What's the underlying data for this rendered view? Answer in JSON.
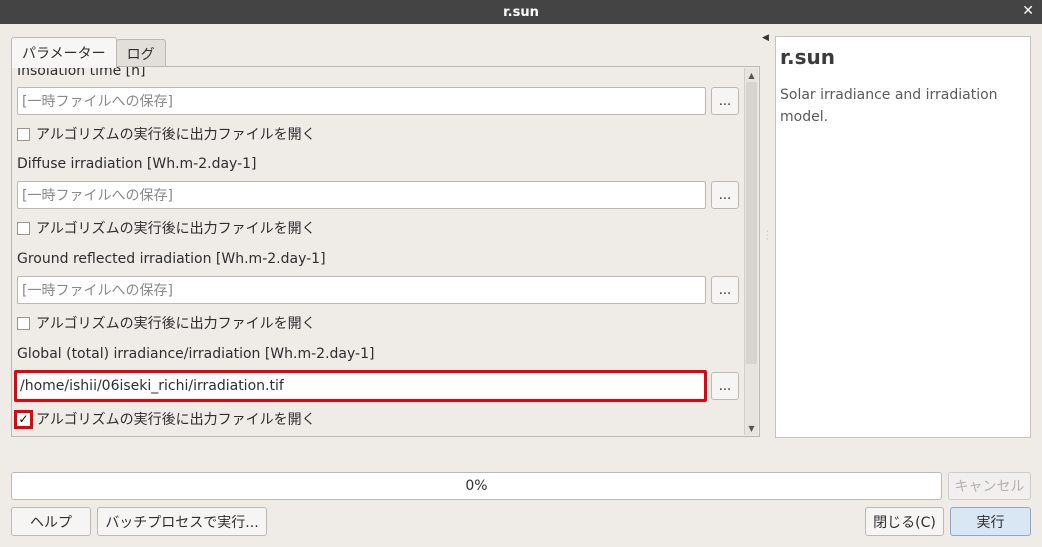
{
  "window": {
    "title": "r.sun",
    "close_icon": "✕"
  },
  "tabs": [
    {
      "label": "パラメーター",
      "active": true
    },
    {
      "label": "ログ",
      "active": false
    }
  ],
  "params": {
    "insolation_label": "Insolation time [h]",
    "temp_placeholder": "[一時ファイルへの保存]",
    "open_after_label": "アルゴリズムの実行後に出力ファイルを開く",
    "browse_label": "...",
    "diffuse_label": "Diffuse irradiation [Wh.m-2.day-1]",
    "ground_label": "Ground reflected irradiation [Wh.m-2.day-1]",
    "global_label": "Global (total) irradiance/irradiation [Wh.m-2.day-1]",
    "global_value": "/home/ishii/06iseki_richi/irradiation.tif",
    "global_checked_mark": "✓"
  },
  "help": {
    "title": "r.sun",
    "description": "Solar irradiance and irradiation model."
  },
  "progress": {
    "text": "0%",
    "value": 0
  },
  "buttons": {
    "cancel": "キャンセル",
    "help": "ヘルプ",
    "batch": "バッチプロセスで実行...",
    "close": "閉じる(C)",
    "run": "実行"
  }
}
